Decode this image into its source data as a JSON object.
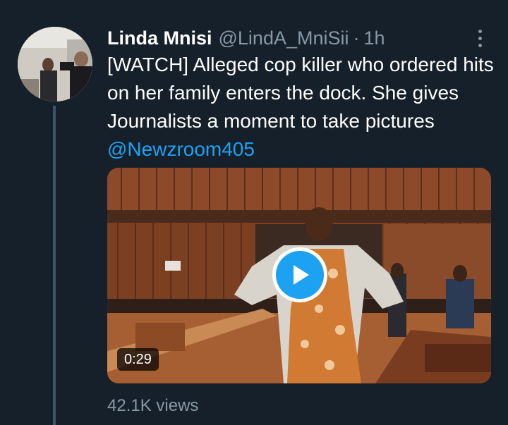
{
  "tweet": {
    "author_name": "Linda Mnisi",
    "author_handle": "@LindA_MniSii",
    "separator": "·",
    "time": "1h",
    "text": "[WATCH] Alleged cop killer who ordered hits on her family enters the dock. She gives Journalists a moment to take pictures ",
    "mention": "@Newzroom405",
    "video_duration": "0:29",
    "views": "42.1K views"
  },
  "icons": {
    "more": "more-vertical-icon",
    "play": "play-icon"
  },
  "colors": {
    "background": "#15202b",
    "accent": "#1da1f2",
    "secondary_text": "#8899a6",
    "thread_line": "#3d5466"
  }
}
